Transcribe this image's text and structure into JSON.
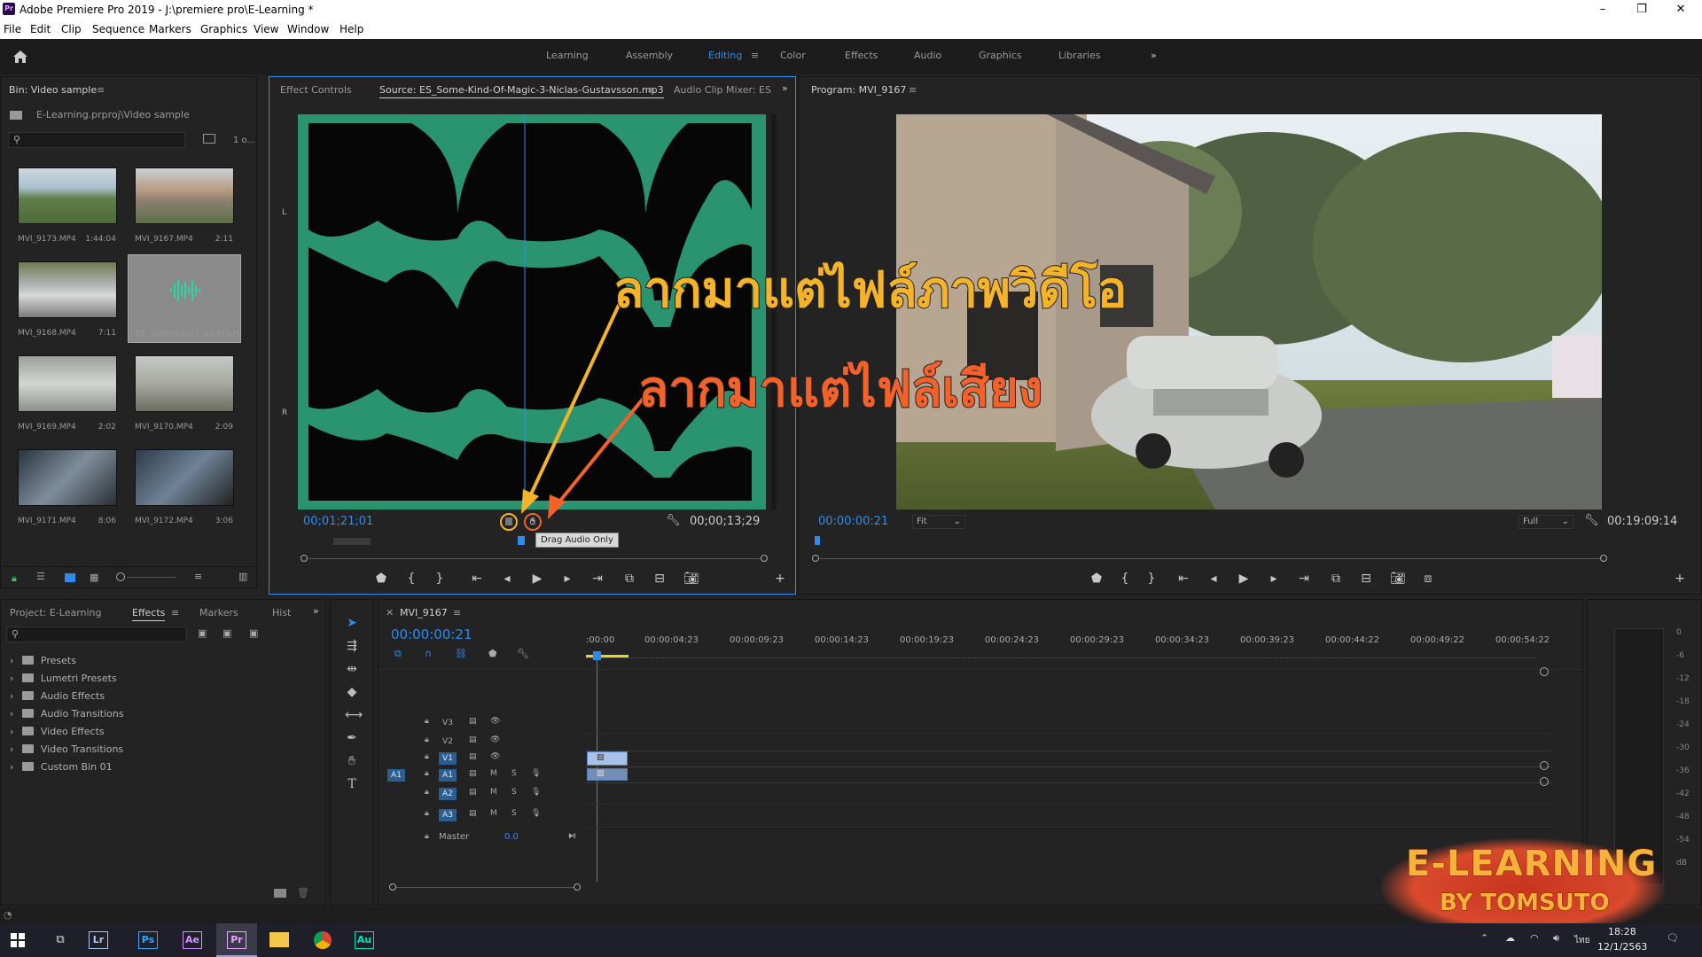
{
  "window": {
    "title": "Adobe Premiere Pro 2019 - J:\\premiere pro\\E-Learning *",
    "logo": "Pr",
    "min": "–",
    "max": "❐",
    "close": "✕"
  },
  "menu": [
    "File",
    "Edit",
    "Clip",
    "Sequence",
    "Markers",
    "Graphics",
    "View",
    "Window",
    "Help"
  ],
  "workspaces": [
    "Learning",
    "Assembly",
    "Editing",
    "Color",
    "Effects",
    "Audio",
    "Graphics",
    "Libraries"
  ],
  "workspace_active": "Editing",
  "bin": {
    "tab": "Bin: Video sample",
    "path": "E-Learning.prproj\\Video sample",
    "count": "1 o...",
    "items": [
      {
        "name": "MVI_9173.MP4",
        "dur": "1:44:04"
      },
      {
        "name": "MVI_9167.MP4",
        "dur": "2:11"
      },
      {
        "name": "MVI_9168.MP4",
        "dur": "7:11"
      },
      {
        "name": "ES_Some-Kind...",
        "dur": "13:47070"
      },
      {
        "name": "MVI_9169.MP4",
        "dur": "2:02"
      },
      {
        "name": "MVI_9170.MP4",
        "dur": "2:09"
      },
      {
        "name": "MVI_9171.MP4",
        "dur": "8:06"
      },
      {
        "name": "MVI_9172.MP4",
        "dur": "3:06"
      }
    ]
  },
  "source": {
    "tabs": [
      "Effect Controls",
      "Source: ES_Some-Kind-Of-Magic-3-Niclas-Gustavsson.mp3",
      "Audio Clip Mixer: ES"
    ],
    "timecode_in": "00;01;21;01",
    "timecode_dur": "00;00;13;29",
    "tooltip": "Drag Audio Only",
    "ch_l": "L",
    "ch_r": "R"
  },
  "program": {
    "tab": "Program: MVI_9167",
    "timecode": "00:00:00:21",
    "fit": "Fit",
    "quality": "Full",
    "duration": "00:19:09:14"
  },
  "project": {
    "tabs": [
      "Project: E-Learning",
      "Effects",
      "Markers",
      "Hist"
    ],
    "active": "Effects",
    "items": [
      "Presets",
      "Lumetri Presets",
      "Audio Effects",
      "Audio Transitions",
      "Video Effects",
      "Video Transitions",
      "Custom Bin 01"
    ]
  },
  "timeline": {
    "tab": "MVI_9167",
    "timecode": "00:00:00:21",
    "ruler": [
      ":00:00",
      "00:00:04:23",
      "00:00:09:23",
      "00:00:14:23",
      "00:00:19:23",
      "00:00:24:23",
      "00:00:29:23",
      "00:00:34:23",
      "00:00:39:23",
      "00:00:44:22",
      "00:00:49:22",
      "00:00:54:22"
    ],
    "tracks": [
      "V3",
      "V2",
      "V1",
      "A1",
      "A2",
      "A3"
    ],
    "source_patch": "A1",
    "master": "Master",
    "master_val": "0.0",
    "m": "M",
    "s": "S"
  },
  "meter": [
    "0",
    "-6",
    "-12",
    "-18",
    "-24",
    "-30",
    "-36",
    "-42",
    "-48",
    "-54",
    "dB"
  ],
  "overlay": {
    "line1": "ลากมาแต่ไฟล์ภาพวิดีโอ",
    "line2": "ลากมาแต่ไฟล์เสียง",
    "brand1": "E-LEARNING",
    "brand2": "BY TOMSUTO"
  },
  "taskbar": {
    "apps": [
      "Lr",
      "Ps",
      "Ae",
      "Pr",
      "Au"
    ],
    "time": "18:28",
    "date": "12/1/2563",
    "lang": "ไทย"
  },
  "colors": {
    "accent": "#2d8ceb",
    "waveform": "#2fa37a",
    "overlay1": "#f5b32a",
    "overlay2": "#f2622a"
  }
}
